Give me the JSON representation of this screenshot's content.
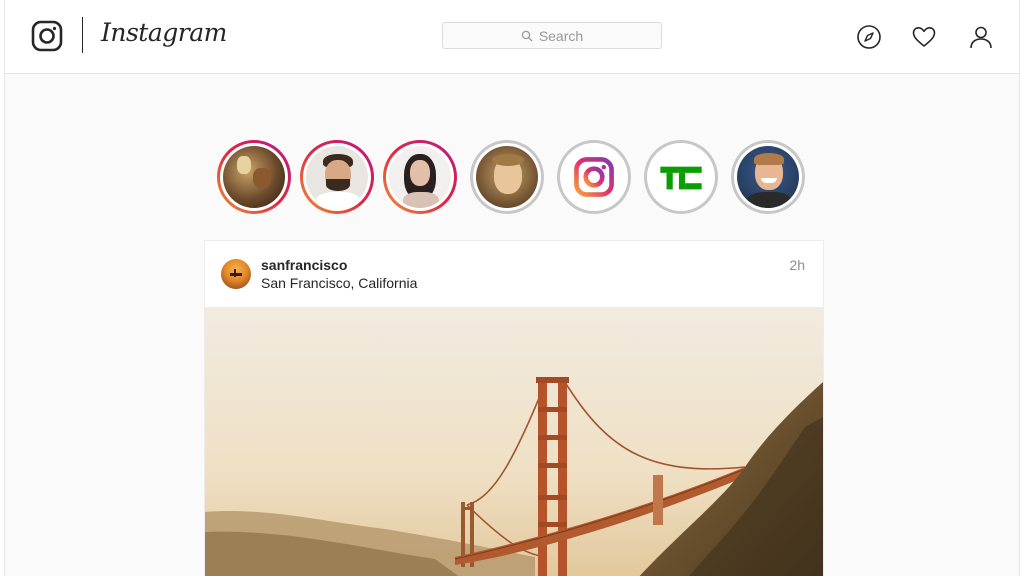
{
  "header": {
    "logo_text": "Instagram",
    "search_placeholder": "Search"
  },
  "icons": {
    "logo": "instagram-camera-icon",
    "search": "search-icon",
    "explore": "compass-icon",
    "activity": "heart-icon",
    "profile": "person-icon"
  },
  "stories": [
    {
      "type": "photo",
      "seen": false
    },
    {
      "type": "photo",
      "seen": false
    },
    {
      "type": "photo",
      "seen": false
    },
    {
      "type": "photo",
      "seen": true
    },
    {
      "type": "instagram-logo",
      "seen": true
    },
    {
      "type": "techcrunch-logo",
      "seen": true,
      "label": "TC"
    },
    {
      "type": "photo",
      "seen": true
    }
  ],
  "post": {
    "username": "sanfrancisco",
    "location": "San Francisco, California",
    "time": "2h"
  },
  "colors": {
    "story_ring_gradient": [
      "#f09433",
      "#dc2743",
      "#bc1888"
    ],
    "seen_ring": "#c7c7c7",
    "techcrunch_green": "#0a9e01"
  }
}
